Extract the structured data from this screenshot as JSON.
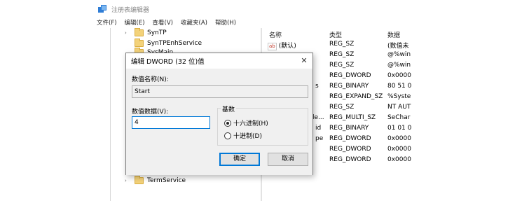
{
  "app": {
    "title": "注册表编辑器",
    "menu": [
      "文件(F)",
      "编辑(E)",
      "查看(V)",
      "收藏夹(A)",
      "帮助(H)"
    ]
  },
  "tree": {
    "items": [
      {
        "label": "SynTP",
        "arrow": "›"
      },
      {
        "label": "SynTPEnhService",
        "arrow": ""
      },
      {
        "label": "SysMain",
        "arrow": ""
      },
      {
        "label": "TermService",
        "arrow": "›"
      }
    ]
  },
  "values_pane": {
    "headers": {
      "name": "名称",
      "type": "类型",
      "data": "数据"
    },
    "rows": [
      {
        "name": "(默认)",
        "type": "REG_SZ",
        "data": "(数值未",
        "icon": "ab-string-icon"
      },
      {
        "name": "",
        "type": "REG_SZ",
        "data": "@%win"
      },
      {
        "name": "",
        "type": "REG_SZ",
        "data": "@%win"
      },
      {
        "name": "",
        "type": "REG_DWORD",
        "data": "0x0000"
      },
      {
        "name": "s",
        "type": "REG_BINARY",
        "data": "80 51 0"
      },
      {
        "name": "",
        "type": "REG_EXPAND_SZ",
        "data": "%Syste"
      },
      {
        "name": "",
        "type": "REG_SZ",
        "data": "NT AUT"
      },
      {
        "name": "le...",
        "type": "REG_MULTI_SZ",
        "data": "SeChar"
      },
      {
        "name": "id",
        "type": "REG_BINARY",
        "data": "01 01 0"
      },
      {
        "name": "pe",
        "type": "REG_DWORD",
        "data": "0x0000"
      },
      {
        "name": "",
        "type": "REG_DWORD",
        "data": "0x0000"
      },
      {
        "name": "",
        "type": "REG_DWORD",
        "data": "0x0000"
      }
    ]
  },
  "dialog": {
    "title": "编辑 DWORD (32 位)值",
    "close_glyph": "✕",
    "name_label": "数值名称(N):",
    "name_value": "Start",
    "data_label": "数值数据(V):",
    "data_value": "4",
    "base_label": "基数",
    "hex_label": "十六进制(H)",
    "dec_label": "十进制(D)",
    "ok_label": "确定",
    "cancel_label": "取消"
  }
}
